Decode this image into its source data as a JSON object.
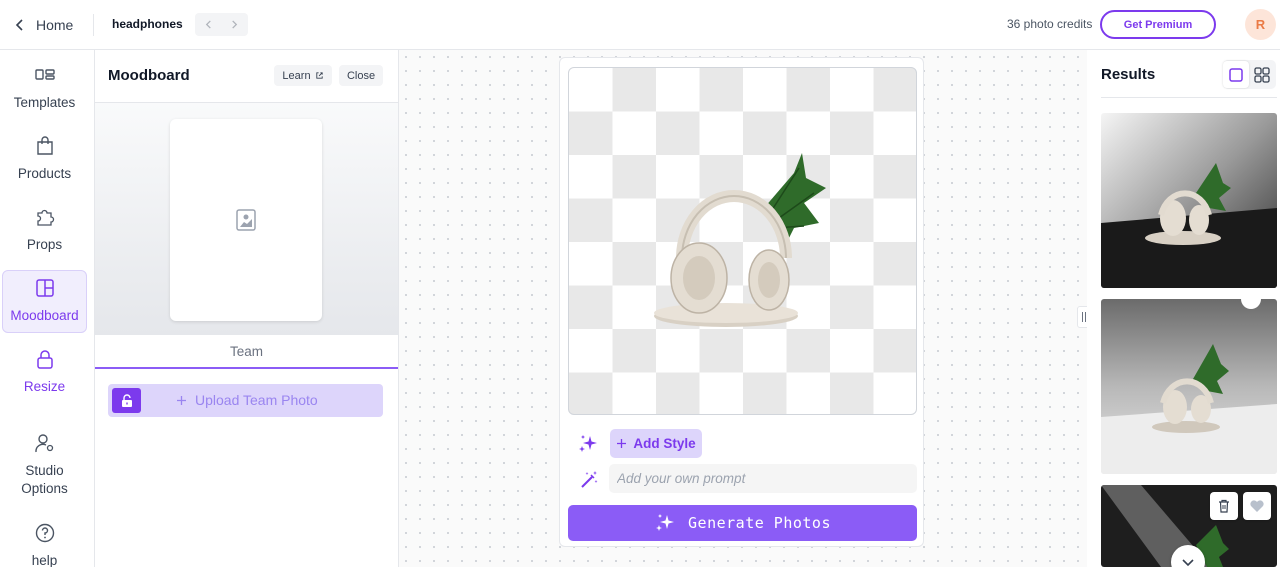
{
  "topbar": {
    "home_label": "Home",
    "project_name": "headphones",
    "credits_text": "36 photo credits",
    "premium_label": "Get Premium",
    "avatar_initial": "R"
  },
  "leftnav": {
    "items": [
      {
        "label": "Templates",
        "icon": "templates-icon"
      },
      {
        "label": "Products",
        "icon": "shopping-bag-icon"
      },
      {
        "label": "Props",
        "icon": "puzzle-icon"
      },
      {
        "label": "Moodboard",
        "icon": "moodboard-icon",
        "active": true
      },
      {
        "label": "Resize",
        "icon": "lock-icon"
      },
      {
        "label": "Studio Options",
        "icon": "user-settings-icon"
      },
      {
        "label": "help",
        "icon": "help-icon"
      }
    ]
  },
  "panel": {
    "title": "Moodboard",
    "learn_label": "Learn",
    "close_label": "Close",
    "tab_label": "Team",
    "upload_label": "Upload Team Photo"
  },
  "editor": {
    "add_style_label": "Add Style",
    "prompt_placeholder": "Add your own prompt",
    "generate_label": "Generate Photos"
  },
  "results": {
    "title": "Results"
  },
  "colors": {
    "accent": "#7c3aed",
    "accent_light": "#ddd5fb",
    "generate_bg": "#8b5cf6"
  }
}
